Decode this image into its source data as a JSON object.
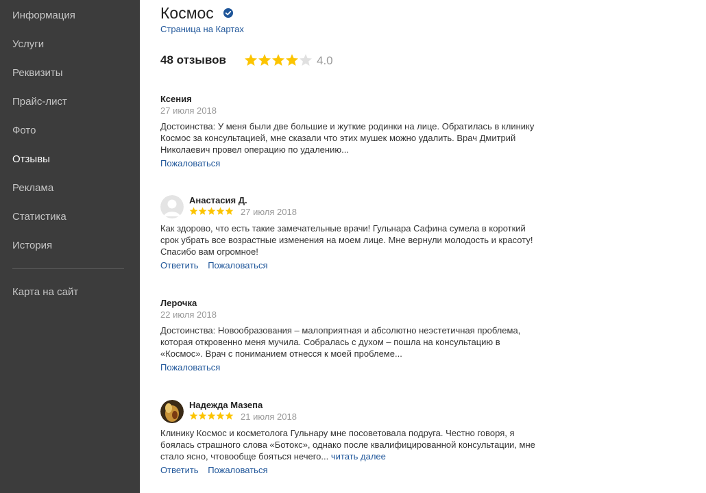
{
  "sidebar": {
    "items": [
      {
        "label": "Информация"
      },
      {
        "label": "Услуги"
      },
      {
        "label": "Реквизиты"
      },
      {
        "label": "Прайс-лист"
      },
      {
        "label": "Фото"
      },
      {
        "label": "Отзывы",
        "active": true
      },
      {
        "label": "Реклама"
      },
      {
        "label": "Статистика"
      },
      {
        "label": "История"
      }
    ],
    "bottom_item": "Карта на сайт"
  },
  "org": {
    "title": "Космос",
    "verified_icon": "verified-check-icon",
    "maps_link": "Страница на Картах"
  },
  "summary": {
    "count_label": "48 отзывов",
    "rating": 4.0,
    "rating_label": "4.0"
  },
  "colors": {
    "sidebar_bg": "#3c3c3c",
    "link": "#1e5599",
    "star": "#fcc400",
    "star_empty": "#e0e0e0",
    "verified": "#1e5599"
  },
  "reviews": [
    {
      "author": "Ксения",
      "date": "27 июля 2018",
      "text": "Достоинства: У меня были две большие и жуткие родинки на лице. Обратилась в клинику Космос за консультацией, мне сказали что этих мушек можно удалить. Врач Дмитрий Николаевич провел операцию по удалению...",
      "actions": [
        "Пожаловаться"
      ]
    },
    {
      "author": "Анастасия Д.",
      "date": "27 июля 2018",
      "stars": 5,
      "avatar": "default-avatar",
      "text": "Как здорово, что есть такие замечательные врачи! Гульнара Сафина сумела в короткий срок убрать все возрастные изменения на моем лице. Мне вернули молодость и красоту! Спасибо вам огромное!",
      "actions": [
        "Ответить",
        "Пожаловаться"
      ]
    },
    {
      "author": "Лерочка",
      "date": "22 июля 2018",
      "text": "Достоинства: Новообразования – малоприятная и абсолютно неэстетичная проблема, которая откровенно меня мучила. Собралась с духом – пошла на консультацию в «Космос». Врач с пониманием отнесся к моей проблеме...",
      "actions": [
        "Пожаловаться"
      ]
    },
    {
      "author": "Надежда Мазепа",
      "date": "21 июля 2018",
      "stars": 5,
      "avatar": "user-photo",
      "text": "Клинику Космос и косметолога Гульнару мне посоветовала подруга. Честно говоря, я боялась страшного слова «Ботокс», однако после квалифицированной консультации, мне стало ясно, чтовообще бояться нечего...",
      "more_label": "читать далее",
      "actions": [
        "Ответить",
        "Пожаловаться"
      ]
    }
  ]
}
